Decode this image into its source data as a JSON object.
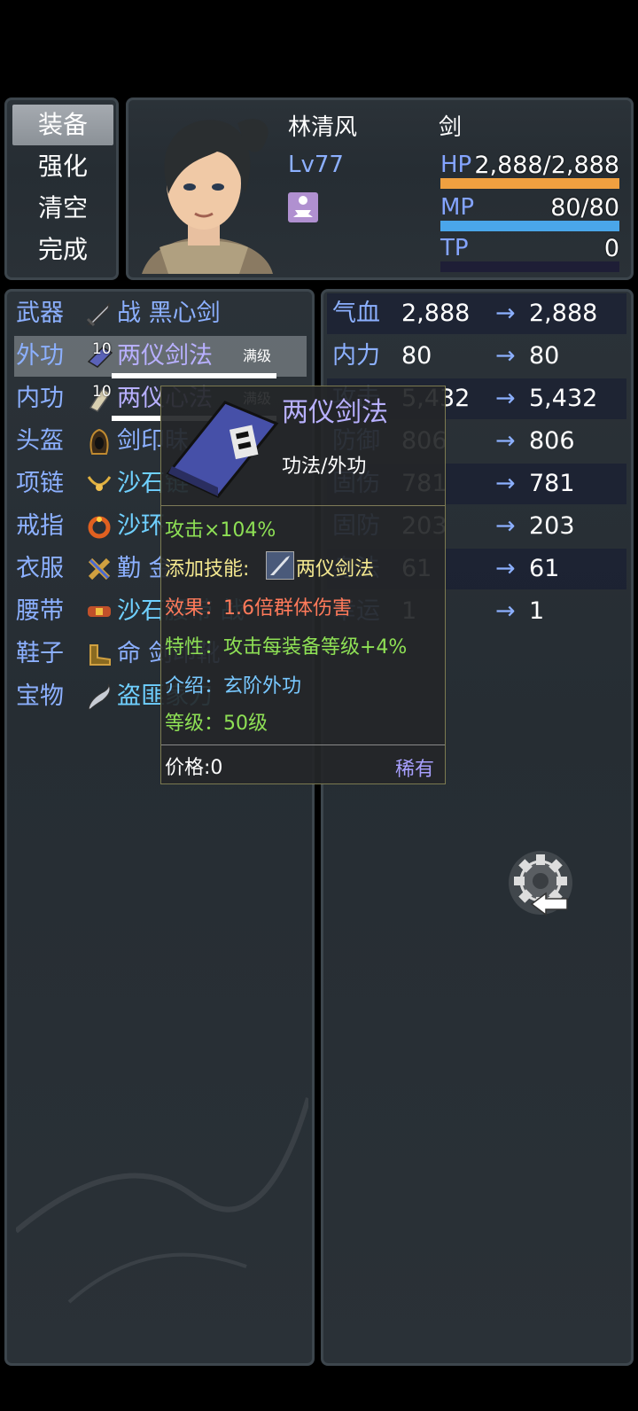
{
  "menu": {
    "items": [
      "装备",
      "强化",
      "清空",
      "完成"
    ],
    "selected": 0
  },
  "actor": {
    "name": "林清风",
    "class": "剑",
    "level": "Lv77",
    "state_icon": "meditation-icon",
    "hp": {
      "label": "HP",
      "text": "2,888/2,888",
      "fraction": 1.0,
      "color": "#f0a040"
    },
    "mp": {
      "label": "MP",
      "text": "80/80",
      "fraction": 1.0,
      "color": "#4aa6ea"
    },
    "tp": {
      "label": "TP",
      "text": "0",
      "fraction": 0.0,
      "color": "#60c060"
    }
  },
  "equipment": [
    {
      "slot": "武器",
      "icon": "sword-icon",
      "name": "战 黑心剑"
    },
    {
      "slot": "外功",
      "icon": "manual-book-icon",
      "name": "两仪剑法",
      "overlay_num": "10",
      "max_label": "满级",
      "selected": true
    },
    {
      "slot": "内功",
      "icon": "scroll-icon",
      "name": "两仪心法",
      "overlay_num": "10",
      "max_label": "满级"
    },
    {
      "slot": "头盔",
      "icon": "hood-icon",
      "name": "剑印昧"
    },
    {
      "slot": "项链",
      "icon": "necklace-icon",
      "name": "沙石链"
    },
    {
      "slot": "戒指",
      "icon": "ring-icon",
      "name": "沙环"
    },
    {
      "slot": "衣服",
      "icon": "robe-icon",
      "name": "勤 金"
    },
    {
      "slot": "腰带",
      "icon": "belt-icon",
      "name": "沙石腰带 战"
    },
    {
      "slot": "鞋子",
      "icon": "boots-icon",
      "name": "命 剑印靴"
    },
    {
      "slot": "宝物",
      "icon": "sabre-icon",
      "name": "盗匪家刀"
    }
  ],
  "params": [
    {
      "label": "气血",
      "current": "2,888",
      "new": "2,888"
    },
    {
      "label": "内力",
      "current": "80",
      "new": "80"
    },
    {
      "label": "攻击",
      "current": "5,432",
      "new": "5,432"
    },
    {
      "label": "防御",
      "current": "806",
      "new": "806"
    },
    {
      "label": "固伤",
      "current": "781",
      "new": "781"
    },
    {
      "label": "固防",
      "current": "203",
      "new": "203"
    },
    {
      "label": "身法",
      "current": "61",
      "new": "61"
    },
    {
      "label": "幸运",
      "current": "1",
      "new": "1"
    }
  ],
  "arrow_glyph": "→",
  "tooltip": {
    "title": "两仪剑法",
    "type": "功法/外功",
    "attack_line": "攻击×104%",
    "skill_label": "添加技能:",
    "skill_name": "两仪剑法",
    "effect": "效果：1.6倍群体伤害",
    "trait": "特性：攻击每装备等级+4%",
    "intro": "介绍：玄阶外功",
    "level": "等级：50级",
    "price": "价格:0",
    "rarity": "稀有"
  },
  "colors": {
    "label_blue": "#8cb0ff",
    "tip_green": "#8ee055",
    "tip_red": "#ff7a5a",
    "tip_cyan": "#78c8ff",
    "tip_yellow": "#f4e890",
    "rarity_purple": "#a8a0ff"
  },
  "gear_button_icon": "gear-return-icon"
}
